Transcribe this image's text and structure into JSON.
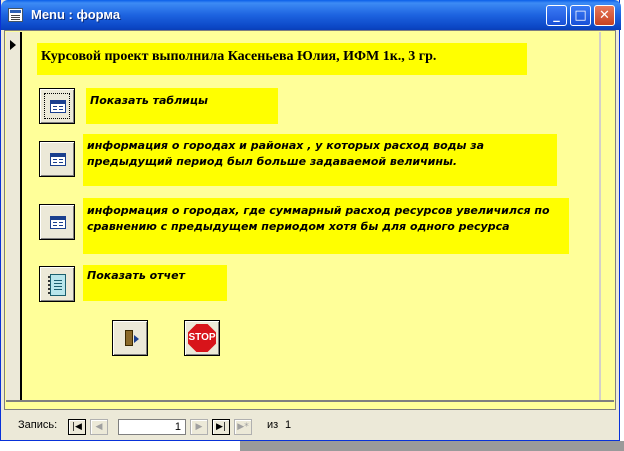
{
  "window": {
    "title": "Menu : форма",
    "minimize_glyph": "_",
    "maximize_glyph": "□",
    "close_glyph": "✕"
  },
  "form": {
    "heading": "Курсовой проект выполнила Касеньева Юлия, ИФМ 1к., 3 гр.",
    "items": [
      {
        "label": "Показать таблицы",
        "icon": "form-icon"
      },
      {
        "label": " информация о городах и районах , у которых расход воды за предыдущий период был больше задаваемой величины.",
        "icon": "form-icon"
      },
      {
        "label": "информация о городах, где суммарный расход  ресурсов увеличился по сравнению с предыдущем периодом хотя бы для одного ресурса",
        "icon": "form-icon"
      },
      {
        "label": "Показать отчет",
        "icon": "report-icon"
      }
    ],
    "exit_icon": "exit-door-icon",
    "stop_label": "STOP"
  },
  "navigation": {
    "record_label": "Запись:",
    "first_glyph": "|◀",
    "prev_glyph": "◀",
    "current_record": "1",
    "next_glyph": "▶",
    "last_glyph": "▶|",
    "new_glyph": "▶*",
    "of_label": "из",
    "total_records": "1"
  },
  "colors": {
    "form_background": "#ffff99",
    "label_background": "#ffff00",
    "titlebar": "#0a5fe9",
    "stop_red": "#d8141a"
  }
}
